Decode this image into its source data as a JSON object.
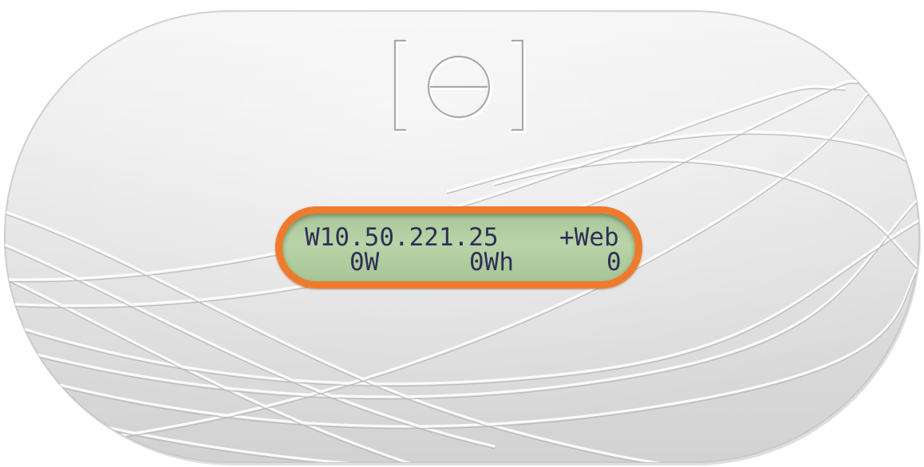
{
  "device": {
    "logo_text": "[e]",
    "colors": {
      "shell": "#e4e4e4",
      "bezel": "#ef7a2c",
      "lcd": "#b3cfa3",
      "lcd_text": "#2f2f56"
    }
  },
  "lcd": {
    "line1": {
      "ip": "W10.50.221.25",
      "status": "+Web"
    },
    "line2": {
      "power": "0W",
      "energy": "0Wh",
      "counter": "0"
    }
  }
}
